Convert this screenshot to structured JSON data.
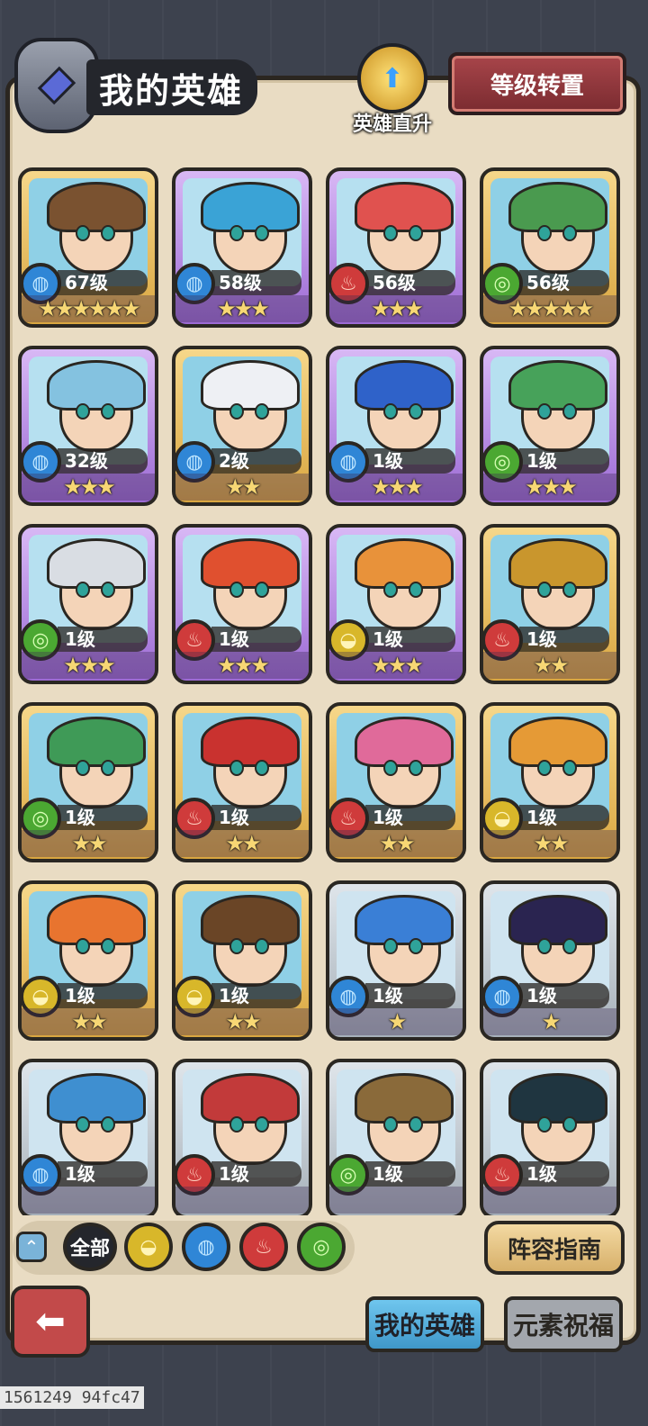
{
  "header": {
    "title": "我的英雄",
    "ascend_label": "英雄直升",
    "level_transfer_label": "等级转置"
  },
  "heroes": [
    {
      "level": "67级",
      "element": "water",
      "rarity": "gold",
      "stars": "★★★★★★",
      "hair": "#7a5230"
    },
    {
      "level": "58级",
      "element": "water",
      "rarity": "purple",
      "stars": "★★★",
      "hair": "#3aa3d6"
    },
    {
      "level": "56级",
      "element": "fire",
      "rarity": "purple",
      "stars": "★★★",
      "hair": "#e0524f"
    },
    {
      "level": "56级",
      "element": "wind",
      "rarity": "gold",
      "stars": "★★★★★",
      "hair": "#4a9a4f"
    },
    {
      "level": "32级",
      "element": "water",
      "rarity": "purple",
      "stars": "★★★",
      "hair": "#84c2e0"
    },
    {
      "level": "2级",
      "element": "water",
      "rarity": "gold",
      "stars": "★★",
      "hair": "#eef0f4"
    },
    {
      "level": "1级",
      "element": "water",
      "rarity": "purple",
      "stars": "★★★",
      "hair": "#2f62c9"
    },
    {
      "level": "1级",
      "element": "wind",
      "rarity": "purple",
      "stars": "★★★",
      "hair": "#47a25a"
    },
    {
      "level": "1级",
      "element": "wind",
      "rarity": "purple",
      "stars": "★★★",
      "hair": "#d9dde3"
    },
    {
      "level": "1级",
      "element": "fire",
      "rarity": "purple",
      "stars": "★★★",
      "hair": "#e0502f"
    },
    {
      "level": "1级",
      "element": "earth",
      "rarity": "purple",
      "stars": "★★★",
      "hair": "#e8923a"
    },
    {
      "level": "1级",
      "element": "fire",
      "rarity": "gold",
      "stars": "★★",
      "hair": "#c9962d"
    },
    {
      "level": "1级",
      "element": "wind",
      "rarity": "gold",
      "stars": "★★",
      "hair": "#3f9a57"
    },
    {
      "level": "1级",
      "element": "fire",
      "rarity": "gold",
      "stars": "★★",
      "hair": "#c9322f"
    },
    {
      "level": "1级",
      "element": "fire",
      "rarity": "gold",
      "stars": "★★",
      "hair": "#e06a9a"
    },
    {
      "level": "1级",
      "element": "earth",
      "rarity": "gold",
      "stars": "★★",
      "hair": "#e59a36"
    },
    {
      "level": "1级",
      "element": "earth",
      "rarity": "gold",
      "stars": "★★",
      "hair": "#e8742f"
    },
    {
      "level": "1级",
      "element": "earth",
      "rarity": "gold",
      "stars": "★★",
      "hair": "#6a4526"
    },
    {
      "level": "1级",
      "element": "water",
      "rarity": "grey",
      "stars": "★",
      "hair": "#3a7fd6"
    },
    {
      "level": "1级",
      "element": "water",
      "rarity": "grey",
      "stars": "★",
      "hair": "#2a2450"
    },
    {
      "level": "1级",
      "element": "water",
      "rarity": "grey",
      "stars": "",
      "hair": "#3f8fd0"
    },
    {
      "level": "1级",
      "element": "fire",
      "rarity": "grey",
      "stars": "",
      "hair": "#c23a3a"
    },
    {
      "level": "1级",
      "element": "wind",
      "rarity": "grey",
      "stars": "",
      "hair": "#8a6a3a"
    },
    {
      "level": "1级",
      "element": "fire",
      "rarity": "grey",
      "stars": "",
      "hair": "#1f3540"
    }
  ],
  "filters": {
    "all_label": "全部",
    "elements": [
      "earth",
      "water",
      "fire",
      "wind"
    ]
  },
  "element_icons": {
    "water": "◍",
    "fire": "♨",
    "wind": "◎",
    "earth": "◒"
  },
  "guide_label": "阵容指南",
  "tabs": {
    "my_heroes": "我的英雄",
    "blessing": "元素祝福"
  },
  "watermark": "1561249 94fc47"
}
